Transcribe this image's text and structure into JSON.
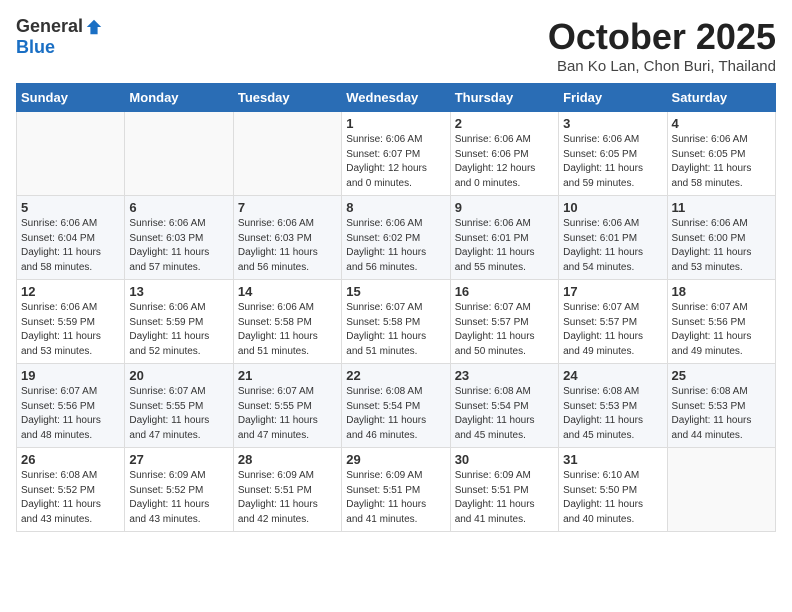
{
  "header": {
    "logo_general": "General",
    "logo_blue": "Blue",
    "month_title": "October 2025",
    "location": "Ban Ko Lan, Chon Buri, Thailand"
  },
  "weekdays": [
    "Sunday",
    "Monday",
    "Tuesday",
    "Wednesday",
    "Thursday",
    "Friday",
    "Saturday"
  ],
  "weeks": [
    [
      {
        "day": "",
        "info": ""
      },
      {
        "day": "",
        "info": ""
      },
      {
        "day": "",
        "info": ""
      },
      {
        "day": "1",
        "info": "Sunrise: 6:06 AM\nSunset: 6:07 PM\nDaylight: 12 hours\nand 0 minutes."
      },
      {
        "day": "2",
        "info": "Sunrise: 6:06 AM\nSunset: 6:06 PM\nDaylight: 12 hours\nand 0 minutes."
      },
      {
        "day": "3",
        "info": "Sunrise: 6:06 AM\nSunset: 6:05 PM\nDaylight: 11 hours\nand 59 minutes."
      },
      {
        "day": "4",
        "info": "Sunrise: 6:06 AM\nSunset: 6:05 PM\nDaylight: 11 hours\nand 58 minutes."
      }
    ],
    [
      {
        "day": "5",
        "info": "Sunrise: 6:06 AM\nSunset: 6:04 PM\nDaylight: 11 hours\nand 58 minutes."
      },
      {
        "day": "6",
        "info": "Sunrise: 6:06 AM\nSunset: 6:03 PM\nDaylight: 11 hours\nand 57 minutes."
      },
      {
        "day": "7",
        "info": "Sunrise: 6:06 AM\nSunset: 6:03 PM\nDaylight: 11 hours\nand 56 minutes."
      },
      {
        "day": "8",
        "info": "Sunrise: 6:06 AM\nSunset: 6:02 PM\nDaylight: 11 hours\nand 56 minutes."
      },
      {
        "day": "9",
        "info": "Sunrise: 6:06 AM\nSunset: 6:01 PM\nDaylight: 11 hours\nand 55 minutes."
      },
      {
        "day": "10",
        "info": "Sunrise: 6:06 AM\nSunset: 6:01 PM\nDaylight: 11 hours\nand 54 minutes."
      },
      {
        "day": "11",
        "info": "Sunrise: 6:06 AM\nSunset: 6:00 PM\nDaylight: 11 hours\nand 53 minutes."
      }
    ],
    [
      {
        "day": "12",
        "info": "Sunrise: 6:06 AM\nSunset: 5:59 PM\nDaylight: 11 hours\nand 53 minutes."
      },
      {
        "day": "13",
        "info": "Sunrise: 6:06 AM\nSunset: 5:59 PM\nDaylight: 11 hours\nand 52 minutes."
      },
      {
        "day": "14",
        "info": "Sunrise: 6:06 AM\nSunset: 5:58 PM\nDaylight: 11 hours\nand 51 minutes."
      },
      {
        "day": "15",
        "info": "Sunrise: 6:07 AM\nSunset: 5:58 PM\nDaylight: 11 hours\nand 51 minutes."
      },
      {
        "day": "16",
        "info": "Sunrise: 6:07 AM\nSunset: 5:57 PM\nDaylight: 11 hours\nand 50 minutes."
      },
      {
        "day": "17",
        "info": "Sunrise: 6:07 AM\nSunset: 5:57 PM\nDaylight: 11 hours\nand 49 minutes."
      },
      {
        "day": "18",
        "info": "Sunrise: 6:07 AM\nSunset: 5:56 PM\nDaylight: 11 hours\nand 49 minutes."
      }
    ],
    [
      {
        "day": "19",
        "info": "Sunrise: 6:07 AM\nSunset: 5:56 PM\nDaylight: 11 hours\nand 48 minutes."
      },
      {
        "day": "20",
        "info": "Sunrise: 6:07 AM\nSunset: 5:55 PM\nDaylight: 11 hours\nand 47 minutes."
      },
      {
        "day": "21",
        "info": "Sunrise: 6:07 AM\nSunset: 5:55 PM\nDaylight: 11 hours\nand 47 minutes."
      },
      {
        "day": "22",
        "info": "Sunrise: 6:08 AM\nSunset: 5:54 PM\nDaylight: 11 hours\nand 46 minutes."
      },
      {
        "day": "23",
        "info": "Sunrise: 6:08 AM\nSunset: 5:54 PM\nDaylight: 11 hours\nand 45 minutes."
      },
      {
        "day": "24",
        "info": "Sunrise: 6:08 AM\nSunset: 5:53 PM\nDaylight: 11 hours\nand 45 minutes."
      },
      {
        "day": "25",
        "info": "Sunrise: 6:08 AM\nSunset: 5:53 PM\nDaylight: 11 hours\nand 44 minutes."
      }
    ],
    [
      {
        "day": "26",
        "info": "Sunrise: 6:08 AM\nSunset: 5:52 PM\nDaylight: 11 hours\nand 43 minutes."
      },
      {
        "day": "27",
        "info": "Sunrise: 6:09 AM\nSunset: 5:52 PM\nDaylight: 11 hours\nand 43 minutes."
      },
      {
        "day": "28",
        "info": "Sunrise: 6:09 AM\nSunset: 5:51 PM\nDaylight: 11 hours\nand 42 minutes."
      },
      {
        "day": "29",
        "info": "Sunrise: 6:09 AM\nSunset: 5:51 PM\nDaylight: 11 hours\nand 41 minutes."
      },
      {
        "day": "30",
        "info": "Sunrise: 6:09 AM\nSunset: 5:51 PM\nDaylight: 11 hours\nand 41 minutes."
      },
      {
        "day": "31",
        "info": "Sunrise: 6:10 AM\nSunset: 5:50 PM\nDaylight: 11 hours\nand 40 minutes."
      },
      {
        "day": "",
        "info": ""
      }
    ]
  ]
}
